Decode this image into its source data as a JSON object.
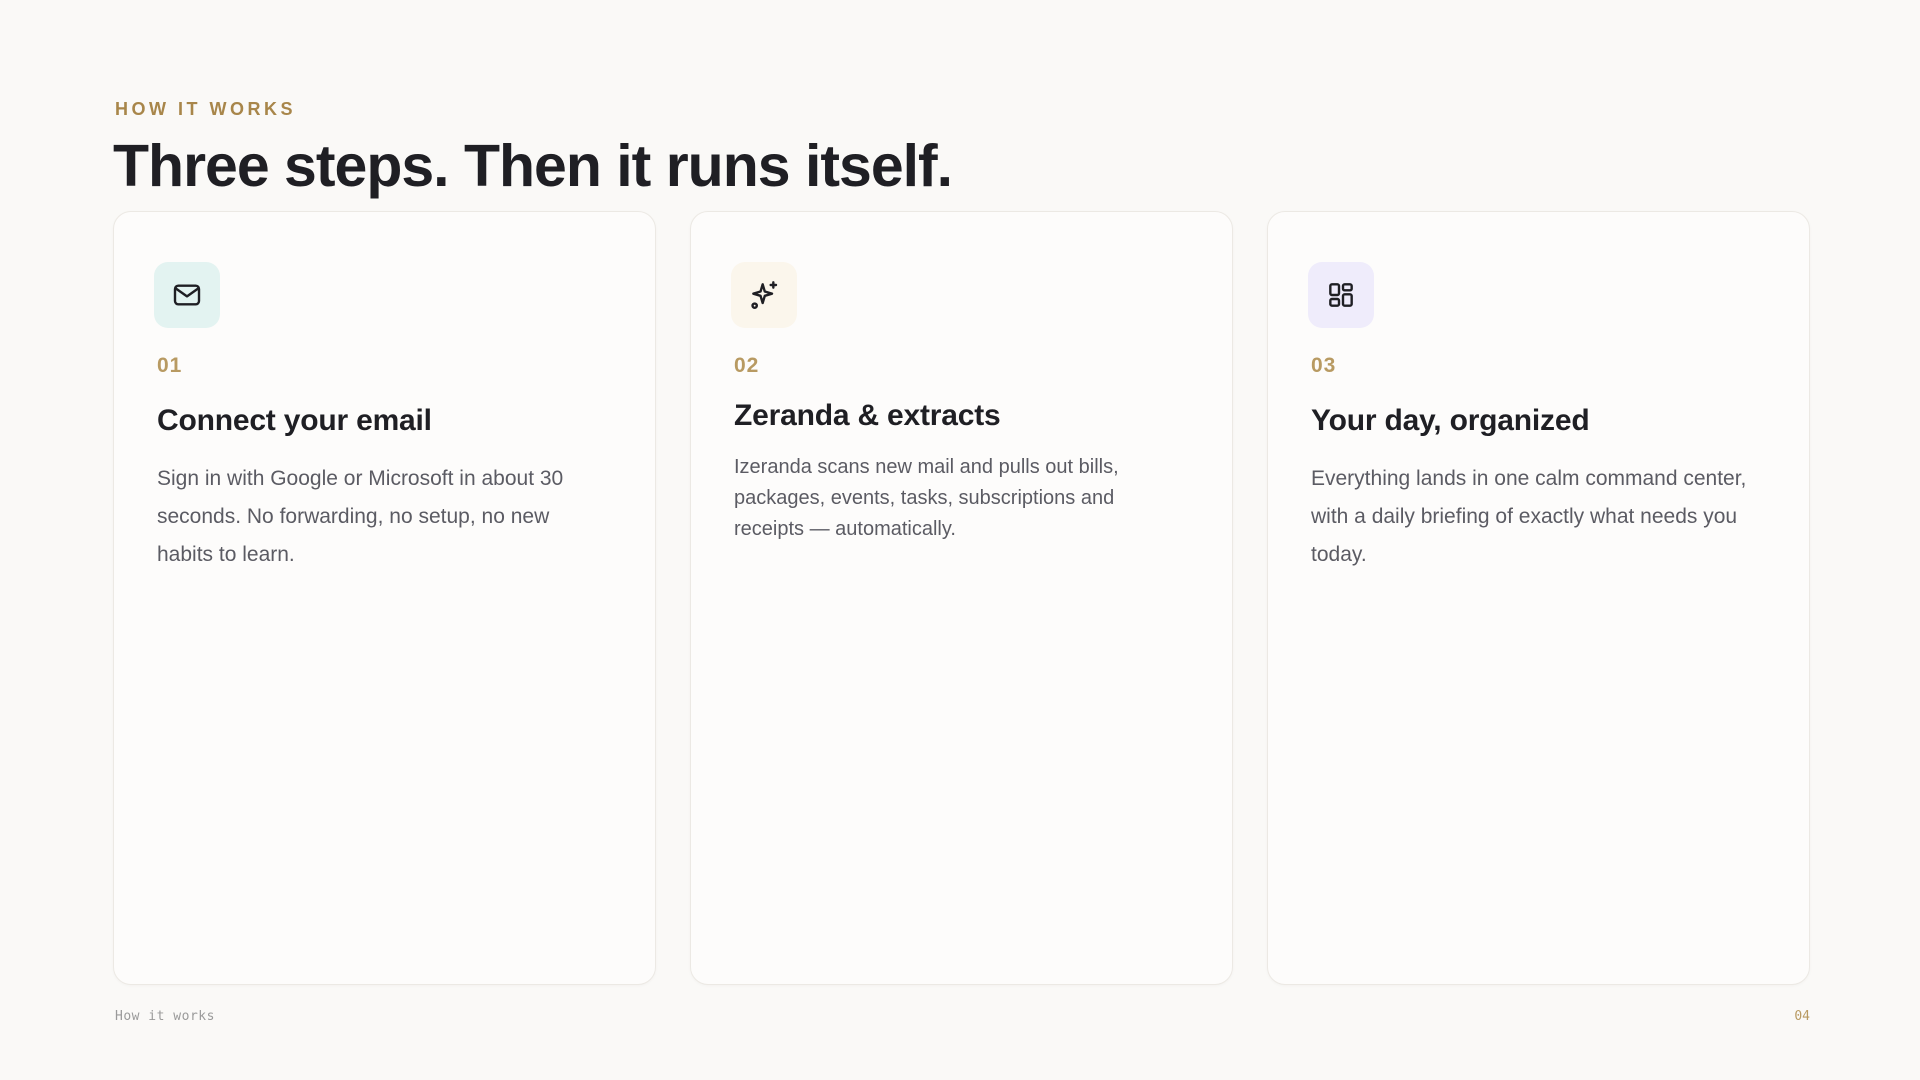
{
  "header": {
    "eyebrow": "HOW IT WORKS",
    "title": "Three steps. Then it runs itself."
  },
  "steps": [
    {
      "number": "01",
      "title": "Connect your email",
      "description": "Sign in with Google or Microsoft in about 30 seconds. No forwarding, no setup, no new habits to learn.",
      "icon": "mail-icon",
      "icon_bg": "#e3f3f1"
    },
    {
      "number": "02",
      "title": "Zeranda & extracts",
      "description": "Izeranda scans new mail and pulls out bills, packages, events, tasks, subscriptions and receipts — automatically.",
      "icon": "sparkles-icon",
      "icon_bg": "#fbf6ec"
    },
    {
      "number": "03",
      "title": "Your day, organized",
      "description": "Everything lands in one calm command center, with a daily briefing of exactly what needs you today.",
      "icon": "dashboard-icon",
      "icon_bg": "#efecfb"
    }
  ],
  "footer": {
    "section_label": "How it works",
    "page_number": "04"
  },
  "colors": {
    "accent": "#a8864a",
    "heading": "#1f1f24",
    "body_text": "#5b5b63",
    "background": "#faf9f7"
  }
}
